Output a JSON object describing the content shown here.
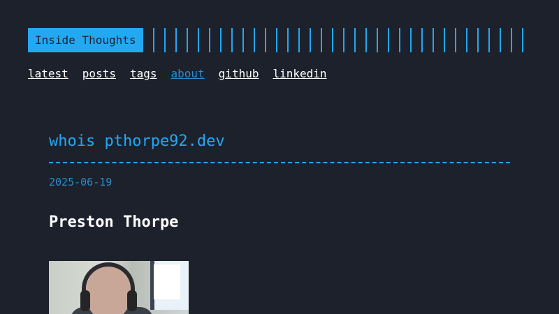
{
  "header": {
    "site_title": "Inside Thoughts"
  },
  "nav": {
    "items": [
      {
        "label": "latest",
        "active": false
      },
      {
        "label": "posts",
        "active": false
      },
      {
        "label": "tags",
        "active": false
      },
      {
        "label": "about",
        "active": true
      },
      {
        "label": "github",
        "active": false
      },
      {
        "label": "linkedin",
        "active": false
      }
    ]
  },
  "post": {
    "title": "whois pthorpe92.dev",
    "date": "2025-06-19",
    "heading": "Preston Thorpe"
  },
  "colors": {
    "background": "#1d212c",
    "accent": "#23a8f2",
    "link_active": "#2a8ccb",
    "text": "#ffffff"
  }
}
